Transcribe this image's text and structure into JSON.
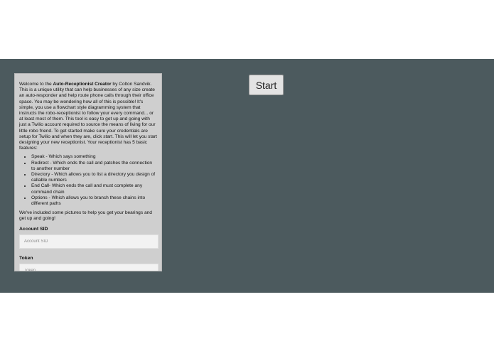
{
  "panel": {
    "intro_before": "Welcome to the ",
    "app_name": "Auto-Receptionist Creator",
    "intro_after": " by Colton Sandvik. This is a unique utility that can help businesses of any size create an auto-responder and help route phone calls through their office space. You may be wondering how all of this is possible! It's simple, you use a flowchart style diagramming system that instructs the robo-receptionist to follow your every command... or at least most of them. This tool is easy to get up and going with just a Twilio account required to source the means of living for our little robo friend. To get started make sure your credentials are setup for Twilio and when they are, click start. This will let you start designing your new receptionist. Your receptionist has 5 basic features:",
    "features": [
      "Speak - Which says something",
      "Redirect - Which ends the call and patches the connection to another number",
      "Directory - Which allows you to list a directory you design of callable numbers",
      "End Call- Which ends the call and must complete any command chain",
      "Options - Which allows you to branch these chains into different paths"
    ],
    "outro": "We've included some pictures to help you get your bearings and get up and going!",
    "account_sid": {
      "label": "Account SID",
      "placeholder": "Account SID",
      "value": ""
    },
    "token": {
      "label": "Token",
      "placeholder": "Token",
      "value": ""
    }
  },
  "start_button": {
    "label": "Start"
  }
}
